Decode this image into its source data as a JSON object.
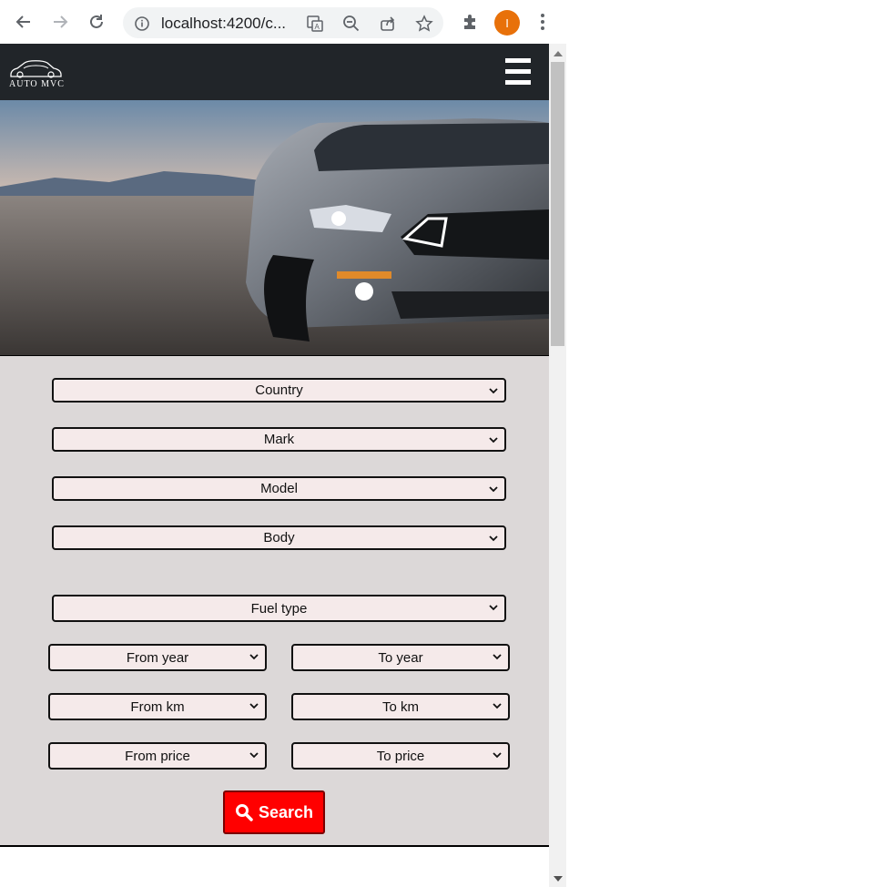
{
  "browser": {
    "url": "localhost:4200/c...",
    "profile_initial": "I"
  },
  "navbar": {
    "logo_text": "AUTO MVC"
  },
  "filters": {
    "country": "Country",
    "mark": "Mark",
    "model": "Model",
    "body": "Body",
    "fuel_type": "Fuel type",
    "from_year": "From year",
    "to_year": "To year",
    "from_km": "From km",
    "to_km": "To km",
    "from_price": "From price",
    "to_price": "To price"
  },
  "search_button": {
    "label": "Search"
  },
  "colors": {
    "navbar": "#212529",
    "form_bg": "#dcd8d8",
    "select_bg": "#f5eaea",
    "search_button": "#ff0000",
    "profile": "#e8710a"
  }
}
